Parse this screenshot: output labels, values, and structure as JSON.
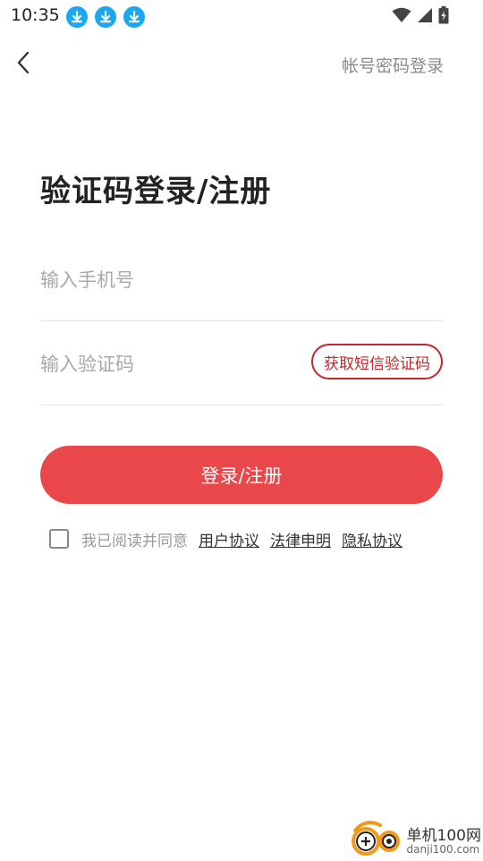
{
  "status_bar": {
    "time": "10:35"
  },
  "nav": {
    "password_login_label": "帐号密码登录"
  },
  "page": {
    "title": "验证码登录/注册"
  },
  "form": {
    "phone_placeholder": "输入手机号",
    "phone_value": "",
    "code_placeholder": "输入验证码",
    "code_value": "",
    "sms_button_label": "获取短信验证码",
    "submit_label": "登录/注册"
  },
  "agreement": {
    "checked": false,
    "prefix_text": "我已阅读并同意",
    "links": [
      "用户协议",
      "法律申明",
      "隐私协议"
    ]
  },
  "watermark": {
    "name": "单机100网",
    "url": "danji100.com"
  },
  "colors": {
    "accent": "#ea474b",
    "accent_dark": "#c4262c",
    "download_icon": "#1aa8f0"
  },
  "icons": [
    "download-icon",
    "wifi-icon",
    "signal-icon",
    "battery-icon",
    "back-arrow-icon",
    "checkbox-icon"
  ]
}
